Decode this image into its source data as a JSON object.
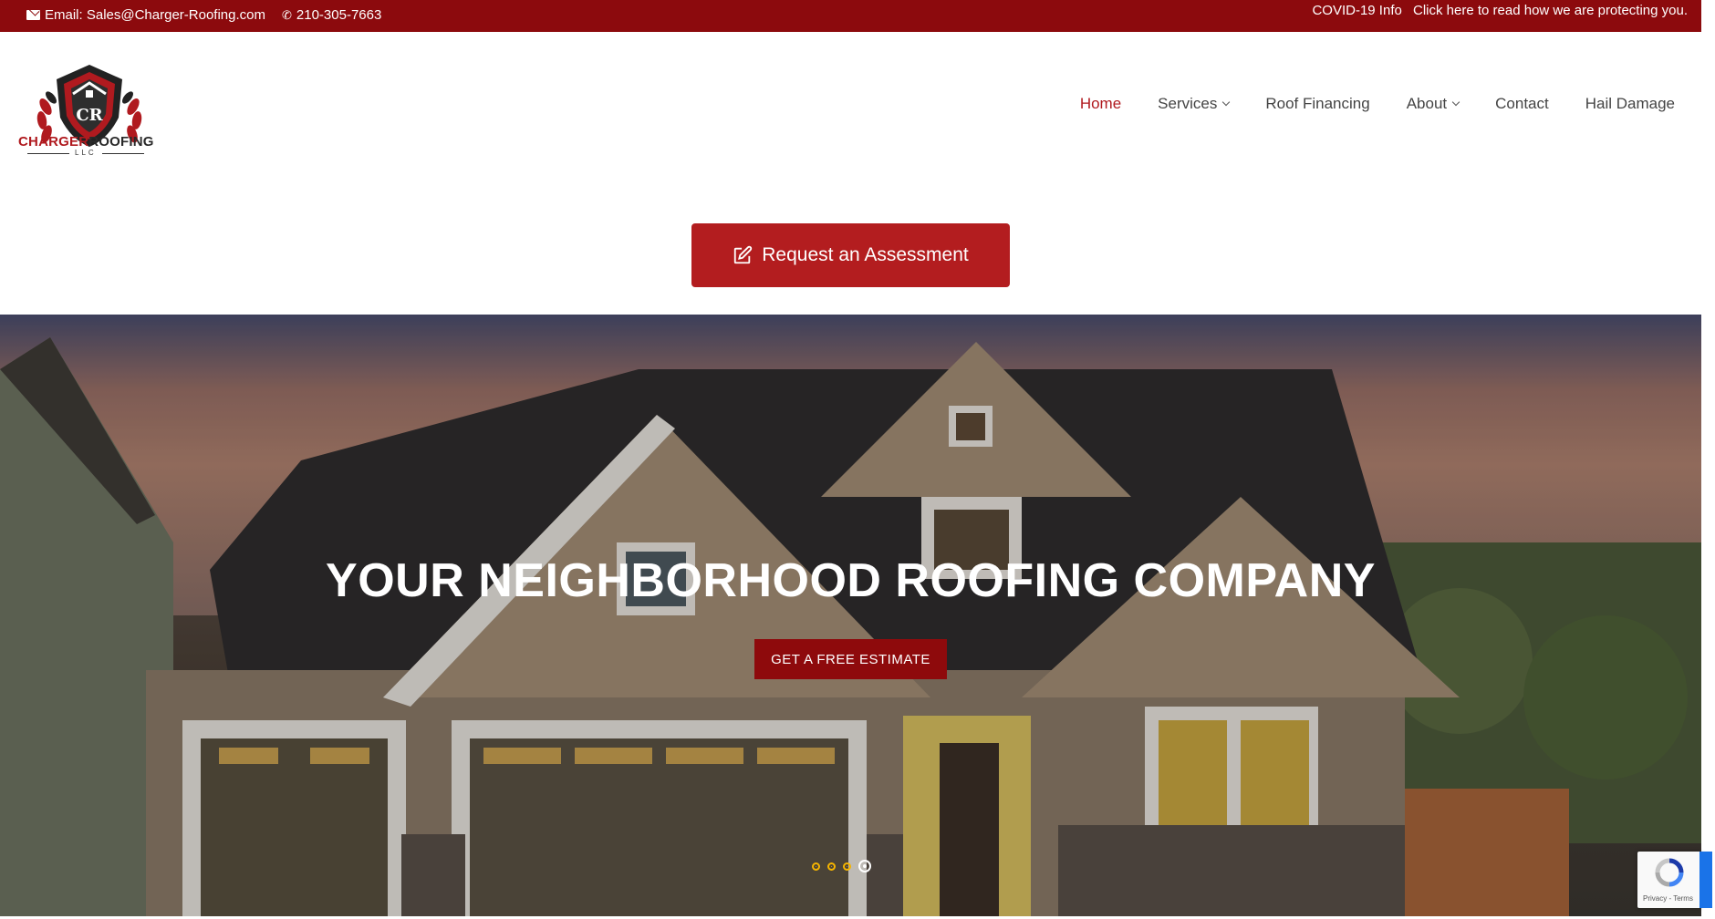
{
  "topbar": {
    "email_label": "Email: Sales@Charger-Roofing.com",
    "phone": "210-305-7663",
    "covid_label": "COVID-19 Info",
    "covid_link": "Click here to read how we are protecting you."
  },
  "logo": {
    "word1": "CHARGER",
    "word2": "ROOFING",
    "sub": "LLC"
  },
  "nav": {
    "items": [
      {
        "label": "Home",
        "active": true
      },
      {
        "label": "Services",
        "dropdown": true
      },
      {
        "label": "Roof Financing"
      },
      {
        "label": "About",
        "dropdown": true
      },
      {
        "label": "Contact"
      },
      {
        "label": "Hail Damage"
      }
    ]
  },
  "cta": {
    "label": "Request an Assessment",
    "icon": "edit-icon"
  },
  "hero": {
    "title": "YOUR NEIGHBORHOOD ROOFING COMPANY",
    "button": "GET A FREE ESTIMATE",
    "slides_total": 4,
    "active_slide": 4
  },
  "recaptcha": {
    "links": "Privacy - Terms"
  },
  "colors": {
    "brand_red": "#8c0a0d",
    "accent_red": "#b31d1f",
    "dot_yellow": "#f5b400"
  }
}
